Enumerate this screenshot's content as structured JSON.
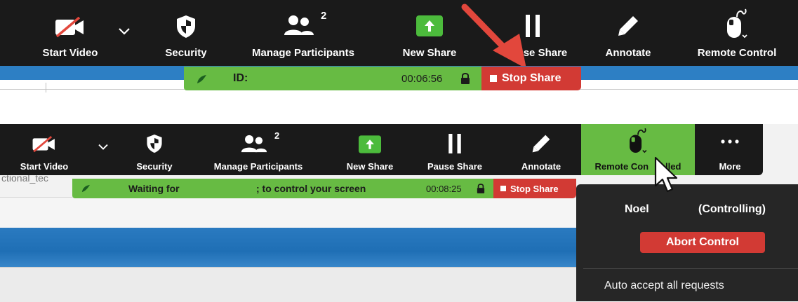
{
  "top": {
    "toolbar": {
      "start_video": "Start Video",
      "security": "Security",
      "manage_participants": "Manage Participants",
      "participant_count": "2",
      "new_share": "New Share",
      "pause_share": "se Share",
      "annotate": "Annotate",
      "remote_control": "Remote Control"
    },
    "share_bar": {
      "id_label": "ID:",
      "timer": "00:06:56",
      "stop_share": "Stop Share"
    }
  },
  "bottom": {
    "toolbar": {
      "start_video": "Start Video",
      "security": "Security",
      "manage_participants": "Manage Participants",
      "participant_count": "2",
      "new_share": "New Share",
      "pause_share": "Pause Share",
      "annotate": "Annotate",
      "remote_controlled_left": "Remote Con",
      "remote_controlled_right": "olled",
      "more": "More"
    },
    "background_text": "ctional_tec",
    "share_bar": {
      "message_left": "Waiting for",
      "message_right": "; to control your screen",
      "timer": "00:08:25",
      "stop_share": "Stop Share"
    },
    "popup": {
      "controller_name": "Noel",
      "controller_status": "(Controlling)",
      "abort_button": "Abort Control",
      "auto_accept": "Auto accept all requests"
    }
  },
  "colors": {
    "toolbar_bg": "#1a1a1a",
    "share_green": "#67bb43",
    "stop_red": "#d23a34",
    "accent_blue": "#2d7fc4",
    "arrow_red": "#e2473c",
    "popup_bg": "#262626"
  }
}
